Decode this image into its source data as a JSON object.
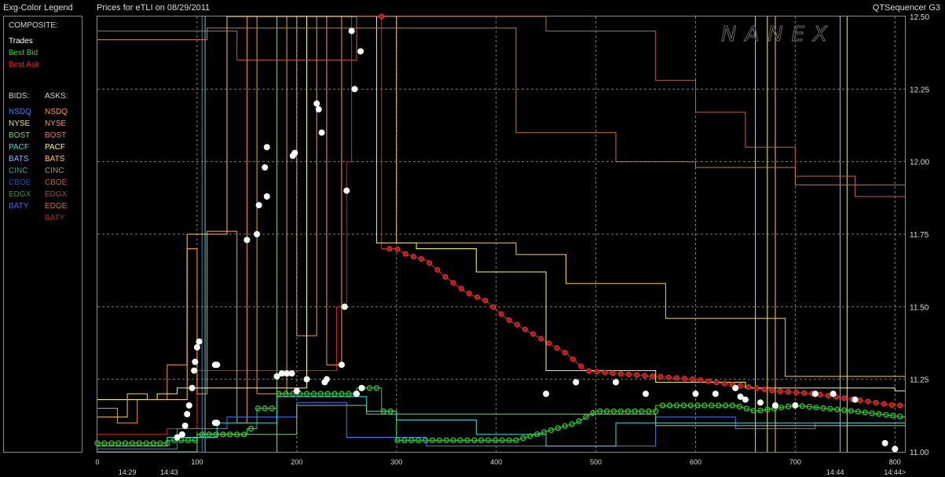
{
  "header": {
    "legend_title": "Exg-Color Legend",
    "chart_title": "Prices for  eTLI  on  08/29/2011",
    "app_name": "QTSequencer G3",
    "watermark": "NANEX"
  },
  "legend": {
    "composite_label": "COMPOSITE:",
    "composite": [
      {
        "label": "Trades",
        "color": "#ffffff"
      },
      {
        "label": "Best Bid",
        "color": "#22dd22"
      },
      {
        "label": "Best Ask",
        "color": "#ee2222"
      }
    ],
    "bids_label": "BIDS:",
    "asks_label": "ASKS:",
    "bids": [
      {
        "label": "NSDQ",
        "color": "#3d7fff"
      },
      {
        "label": "NYSE",
        "color": "#e6e65a"
      },
      {
        "label": "BOST",
        "color": "#86c986"
      },
      {
        "label": "PACF",
        "color": "#33dede"
      },
      {
        "label": "BATS",
        "color": "#9ab4ff"
      },
      {
        "label": "CINC",
        "color": "#2aa6a6"
      },
      {
        "label": "CBOE",
        "color": "#1f49c8"
      },
      {
        "label": "EDGX",
        "color": "#2e9a2e"
      },
      {
        "label": "BATY",
        "color": "#4a6ad8"
      }
    ],
    "asks": [
      {
        "label": "NSDQ",
        "color": "#ff9a3c"
      },
      {
        "label": "NYSE",
        "color": "#ff8c6a"
      },
      {
        "label": "BOST",
        "color": "#e0806a"
      },
      {
        "label": "PACF",
        "color": "#ffff44"
      },
      {
        "label": "BATS",
        "color": "#ffcc55"
      },
      {
        "label": "CINC",
        "color": "#a69a4a"
      },
      {
        "label": "CBOE",
        "color": "#c0603a"
      },
      {
        "label": "EDGX",
        "color": "#b04a2a"
      },
      {
        "label": "EDGE",
        "color": "#c87a3a"
      },
      {
        "label": "BATY",
        "color": "#c02222"
      }
    ]
  },
  "chart_data": {
    "type": "line",
    "title": "Prices for  eTLI  on  08/29/2011",
    "xlim": [
      0,
      810
    ],
    "ylim": [
      11.0,
      12.5
    ],
    "y_ticks": [
      "11.00",
      "11.25",
      "11.50",
      "11.75",
      "12.00",
      "12.25",
      "12.50"
    ],
    "x_ticks": [
      0,
      100,
      200,
      300,
      400,
      500,
      600,
      700,
      800
    ],
    "time_labels": [
      {
        "x": 30,
        "label": "14:29"
      },
      {
        "x": 72,
        "label": "14:43"
      },
      {
        "x": 740,
        "label": "14:44"
      },
      {
        "x": 800,
        "label": "14:44>"
      }
    ],
    "grid": true,
    "series": [
      {
        "name": "Best Ask",
        "color": "#dd2222",
        "points": [
          [
            0,
            11.06
          ],
          [
            70,
            11.06
          ],
          [
            70,
            11.08
          ],
          [
            100,
            11.08
          ],
          [
            100,
            11.28
          ],
          [
            240,
            11.28
          ],
          [
            240,
            11.5
          ],
          [
            250,
            11.5
          ],
          [
            250,
            12.0
          ],
          [
            255,
            12.0
          ],
          [
            255,
            12.5
          ],
          [
            285,
            12.5
          ],
          [
            285,
            11.7
          ],
          [
            300,
            11.7
          ],
          [
            310,
            11.68
          ],
          [
            330,
            11.66
          ],
          [
            350,
            11.6
          ],
          [
            370,
            11.55
          ],
          [
            390,
            11.52
          ],
          [
            410,
            11.46
          ],
          [
            430,
            11.42
          ],
          [
            450,
            11.38
          ],
          [
            470,
            11.34
          ],
          [
            490,
            11.28
          ],
          [
            520,
            11.27
          ],
          [
            560,
            11.26
          ],
          [
            600,
            11.25
          ],
          [
            640,
            11.23
          ],
          [
            680,
            11.21
          ],
          [
            720,
            11.2
          ],
          [
            760,
            11.18
          ],
          [
            800,
            11.16
          ],
          [
            810,
            11.16
          ]
        ]
      },
      {
        "name": "Best Bid",
        "color": "#22dd22",
        "points": [
          [
            0,
            11.03
          ],
          [
            70,
            11.03
          ],
          [
            70,
            11.04
          ],
          [
            100,
            11.04
          ],
          [
            100,
            11.06
          ],
          [
            150,
            11.06
          ],
          [
            150,
            11.08
          ],
          [
            160,
            11.08
          ],
          [
            160,
            11.15
          ],
          [
            180,
            11.15
          ],
          [
            180,
            11.2
          ],
          [
            260,
            11.2
          ],
          [
            260,
            11.22
          ],
          [
            285,
            11.22
          ],
          [
            285,
            11.14
          ],
          [
            300,
            11.14
          ],
          [
            300,
            11.04
          ],
          [
            420,
            11.04
          ],
          [
            440,
            11.06
          ],
          [
            460,
            11.08
          ],
          [
            480,
            11.1
          ],
          [
            500,
            11.14
          ],
          [
            560,
            11.14
          ],
          [
            560,
            11.16
          ],
          [
            640,
            11.16
          ],
          [
            660,
            11.14
          ],
          [
            700,
            11.16
          ],
          [
            760,
            11.14
          ],
          [
            810,
            11.12
          ]
        ]
      },
      {
        "name": "NSDQ ask",
        "color": "#ff9a3c",
        "points": [
          [
            0,
            11.15
          ],
          [
            20,
            11.15
          ],
          [
            20,
            11.1
          ],
          [
            40,
            11.1
          ],
          [
            40,
            11.18
          ],
          [
            70,
            11.18
          ],
          [
            70,
            11.3
          ],
          [
            90,
            11.3
          ],
          [
            90,
            11.7
          ],
          [
            100,
            11.7
          ],
          [
            100,
            11.2
          ],
          [
            110,
            11.2
          ],
          [
            110,
            11.76
          ],
          [
            140,
            11.76
          ],
          [
            140,
            11.1
          ],
          [
            150,
            11.1
          ],
          [
            150,
            12.5
          ],
          [
            160,
            12.5
          ],
          [
            160,
            11.2
          ],
          [
            190,
            11.2
          ],
          [
            190,
            12.5
          ],
          [
            200,
            12.5
          ],
          [
            200,
            11.4
          ],
          [
            220,
            11.4
          ],
          [
            220,
            12.5
          ],
          [
            230,
            12.5
          ],
          [
            230,
            11.3
          ],
          [
            245,
            11.3
          ],
          [
            245,
            12.5
          ],
          [
            300,
            12.5
          ]
        ]
      },
      {
        "name": "PACF ask",
        "color": "#ffff44",
        "points": [
          [
            0,
            11.18
          ],
          [
            60,
            11.18
          ],
          [
            60,
            11.2
          ],
          [
            80,
            11.2
          ],
          [
            80,
            11.22
          ],
          [
            210,
            11.22
          ],
          [
            210,
            12.5
          ],
          [
            280,
            12.5
          ],
          [
            280,
            11.72
          ],
          [
            320,
            11.72
          ],
          [
            320,
            11.7
          ],
          [
            380,
            11.7
          ],
          [
            380,
            11.62
          ],
          [
            450,
            11.62
          ],
          [
            450,
            11.28
          ],
          [
            560,
            11.28
          ],
          [
            560,
            11.24
          ],
          [
            650,
            11.24
          ],
          [
            650,
            11.22
          ],
          [
            800,
            11.22
          ],
          [
            800,
            11.21
          ],
          [
            810,
            11.21
          ]
        ]
      },
      {
        "name": "BATS ask",
        "color": "#ffcc55",
        "points": [
          [
            0,
            11.12
          ],
          [
            30,
            11.12
          ],
          [
            30,
            11.2
          ],
          [
            50,
            11.2
          ],
          [
            50,
            11.18
          ],
          [
            90,
            11.18
          ],
          [
            90,
            11.75
          ],
          [
            130,
            11.75
          ],
          [
            130,
            12.5
          ],
          [
            300,
            12.5
          ],
          [
            300,
            11.72
          ],
          [
            420,
            11.72
          ],
          [
            420,
            11.68
          ],
          [
            470,
            11.68
          ],
          [
            470,
            11.58
          ],
          [
            570,
            11.58
          ],
          [
            570,
            11.46
          ],
          [
            690,
            11.46
          ],
          [
            690,
            11.26
          ],
          [
            810,
            11.26
          ]
        ]
      },
      {
        "name": "CBOE ask",
        "color": "#c0603a",
        "points": [
          [
            0,
            12.45
          ],
          [
            140,
            12.45
          ],
          [
            140,
            12.35
          ],
          [
            260,
            12.35
          ],
          [
            260,
            12.5
          ],
          [
            450,
            12.5
          ],
          [
            450,
            12.45
          ],
          [
            560,
            12.45
          ],
          [
            560,
            12.28
          ],
          [
            600,
            12.28
          ],
          [
            600,
            12.17
          ],
          [
            650,
            12.17
          ],
          [
            650,
            12.05
          ],
          [
            700,
            12.05
          ],
          [
            700,
            11.95
          ],
          [
            760,
            11.95
          ],
          [
            760,
            11.88
          ],
          [
            810,
            11.88
          ]
        ]
      },
      {
        "name": "EDGE ask",
        "color": "#c87a3a",
        "points": [
          [
            0,
            12.42
          ],
          [
            110,
            12.42
          ],
          [
            110,
            12.46
          ],
          [
            420,
            12.46
          ],
          [
            420,
            12.1
          ],
          [
            520,
            12.1
          ],
          [
            520,
            12.0
          ],
          [
            600,
            12.0
          ],
          [
            600,
            11.98
          ],
          [
            700,
            11.98
          ],
          [
            700,
            11.92
          ],
          [
            810,
            11.92
          ]
        ]
      },
      {
        "name": "NSDQ bid",
        "color": "#3d7fff",
        "points": [
          [
            0,
            11.01
          ],
          [
            80,
            11.01
          ],
          [
            80,
            11.08
          ],
          [
            130,
            11.08
          ],
          [
            130,
            11.12
          ],
          [
            200,
            11.12
          ],
          [
            200,
            11.17
          ],
          [
            250,
            11.17
          ],
          [
            250,
            11.05
          ],
          [
            330,
            11.05
          ],
          [
            330,
            11.02
          ],
          [
            560,
            11.02
          ],
          [
            560,
            11.12
          ],
          [
            640,
            11.12
          ],
          [
            640,
            11.08
          ],
          [
            720,
            11.08
          ],
          [
            720,
            11.1
          ],
          [
            810,
            11.1
          ]
        ]
      },
      {
        "name": "PACF bid",
        "color": "#33dede",
        "points": [
          [
            0,
            11.02
          ],
          [
            70,
            11.02
          ],
          [
            70,
            11.05
          ],
          [
            120,
            11.05
          ],
          [
            120,
            11.1
          ],
          [
            180,
            11.1
          ],
          [
            180,
            11.19
          ],
          [
            270,
            11.19
          ],
          [
            270,
            11.14
          ],
          [
            300,
            11.14
          ],
          [
            300,
            11.11
          ],
          [
            380,
            11.11
          ],
          [
            380,
            11.06
          ],
          [
            450,
            11.06
          ],
          [
            450,
            11.02
          ],
          [
            520,
            11.02
          ],
          [
            520,
            11.1
          ],
          [
            810,
            11.1
          ]
        ]
      },
      {
        "name": "BOST bid",
        "color": "#86c986",
        "points": [
          [
            0,
            11.0
          ],
          [
            100,
            11.0
          ],
          [
            100,
            11.06
          ],
          [
            200,
            11.06
          ],
          [
            200,
            11.16
          ],
          [
            270,
            11.16
          ],
          [
            270,
            11.13
          ],
          [
            560,
            11.13
          ],
          [
            560,
            11.09
          ],
          [
            810,
            11.09
          ]
        ]
      }
    ],
    "vertical_spikes": [
      {
        "x": 105,
        "color": "#3d7fff"
      },
      {
        "x": 108,
        "color": "#33dede"
      },
      {
        "x": 180,
        "color": "#86c986"
      },
      {
        "x": 660,
        "color": "#e6e65a"
      },
      {
        "x": 672,
        "color": "#ffff44"
      },
      {
        "x": 680,
        "color": "#ffcc55"
      },
      {
        "x": 745,
        "color": "#ff9a3c"
      },
      {
        "x": 752,
        "color": "#e6e65a"
      }
    ],
    "trades": [
      [
        80,
        11.05
      ],
      [
        85,
        11.06
      ],
      [
        88,
        11.09
      ],
      [
        90,
        11.13
      ],
      [
        92,
        11.16
      ],
      [
        95,
        11.22
      ],
      [
        97,
        11.28
      ],
      [
        98,
        11.31
      ],
      [
        100,
        11.36
      ],
      [
        102,
        11.38
      ],
      [
        118,
        11.3
      ],
      [
        120,
        11.3
      ],
      [
        118,
        11.1
      ],
      [
        120,
        11.1
      ],
      [
        150,
        11.73
      ],
      [
        160,
        11.75
      ],
      [
        162,
        11.85
      ],
      [
        168,
        11.98
      ],
      [
        170,
        12.05
      ],
      [
        170,
        11.88
      ],
      [
        180,
        11.26
      ],
      [
        185,
        11.27
      ],
      [
        190,
        11.27
      ],
      [
        195,
        11.27
      ],
      [
        200,
        11.21
      ],
      [
        198,
        12.03
      ],
      [
        196,
        12.02
      ],
      [
        210,
        11.25
      ],
      [
        220,
        12.2
      ],
      [
        222,
        12.18
      ],
      [
        225,
        12.1
      ],
      [
        228,
        11.24
      ],
      [
        230,
        11.25
      ],
      [
        245,
        11.3
      ],
      [
        248,
        11.5
      ],
      [
        250,
        11.9
      ],
      [
        255,
        12.45
      ],
      [
        258,
        12.25
      ],
      [
        264,
        12.38
      ],
      [
        260,
        11.2
      ],
      [
        265,
        11.22
      ],
      [
        450,
        11.2
      ],
      [
        480,
        11.24
      ],
      [
        520,
        11.24
      ],
      [
        550,
        11.2
      ],
      [
        600,
        11.2
      ],
      [
        620,
        11.2
      ],
      [
        640,
        11.22
      ],
      [
        645,
        11.19
      ],
      [
        650,
        11.18
      ],
      [
        665,
        11.17
      ],
      [
        680,
        11.16
      ],
      [
        700,
        11.16
      ],
      [
        720,
        11.2
      ],
      [
        738,
        11.2
      ],
      [
        760,
        11.18
      ],
      [
        790,
        11.03
      ],
      [
        800,
        11.01
      ]
    ]
  }
}
